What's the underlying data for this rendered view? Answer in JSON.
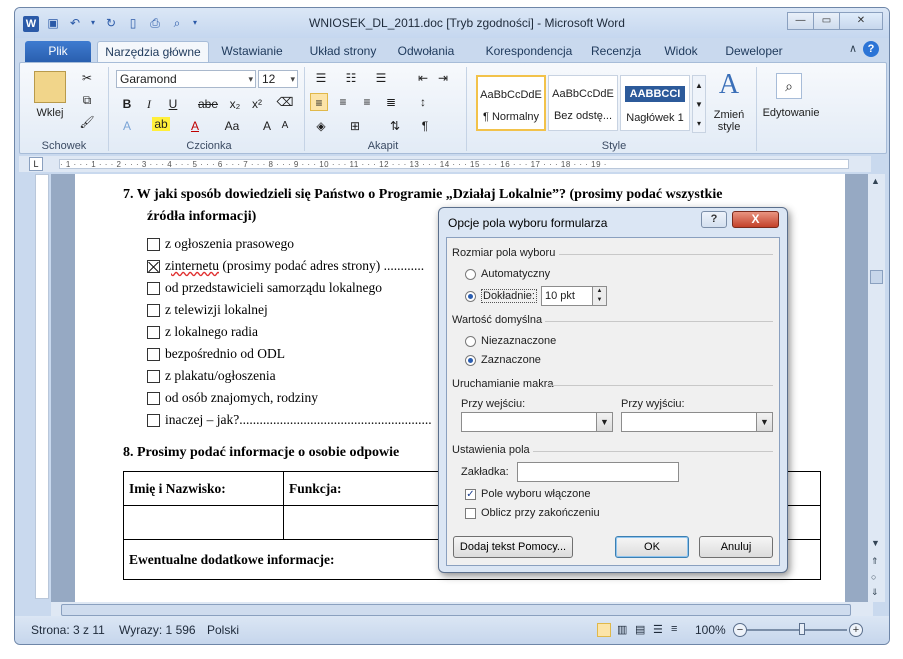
{
  "window": {
    "title": "WNIOSEK_DL_2011.doc [Tryb zgodności] - Microsoft Word",
    "app_letter": "W"
  },
  "tabs": [
    "Plik",
    "Narzędzia główne",
    "Wstawianie",
    "Układ strony",
    "Odwołania",
    "Korespondencja",
    "Recenzja",
    "Widok",
    "Deweloper"
  ],
  "ribbon": {
    "clipboard": {
      "paste": "Wklej",
      "label": "Schowek"
    },
    "font": {
      "family": "Garamond",
      "size": "12",
      "label": "Czcionka",
      "bold": "B",
      "italic": "I",
      "underline": "U",
      "strike": "abe",
      "sub": "x₂",
      "sup": "x²",
      "case": "Aa",
      "grow": "A",
      "shrink": "A"
    },
    "paragraph": {
      "label": "Akapit"
    },
    "styles": {
      "label": "Style",
      "items": [
        {
          "preview": "AaBbCcDdE",
          "name": "¶ Normalny"
        },
        {
          "preview": "AaBbCcDdE",
          "name": "Bez odstę..."
        },
        {
          "preview": "AABBCCI",
          "name": "Nagłówek 1"
        }
      ],
      "change": "Zmień",
      "change2": "style"
    },
    "editing": {
      "label": "Edytowanie"
    }
  },
  "ruler_text": "· 1 · · · 1 · · · 2 · · · 3 · · · 4 · · · 5 · · · 6 · · · 7 · · · 8 · · · 9 · · · 10 · · · 11 · · · 12 · · · 13 · · · 14 · · · 15 · · · 16 · · · 17 · · · 18 · · · 19 ·",
  "document": {
    "q7_line1": "7.   W jaki sposób dowiedzieli się Państwo o Programie „Działaj Lokalnie”? (prosimy podać wszystkie",
    "q7_line2": "źródła informacji)",
    "options": [
      {
        "text": "z ogłoszenia prasowego",
        "checked": false
      },
      {
        "text_pre": "z ",
        "text_sq": "internetu",
        "text_post": " (prosimy podać adres strony) ............",
        "checked": true
      },
      {
        "text": "od przedstawicieli samorządu lokalnego",
        "checked": false
      },
      {
        "text": "z telewizji lokalnej",
        "checked": false
      },
      {
        "text": "z lokalnego radia",
        "checked": false
      },
      {
        "text": "bezpośrednio od ODL",
        "checked": false
      },
      {
        "text": "z plakatu/ogłoszenia",
        "checked": false
      },
      {
        "text": "od osób znajomych, rodziny",
        "checked": false
      },
      {
        "text": "inaczej – jak?.........................................................",
        "checked": false
      }
    ],
    "q8": "8.   Prosimy podać informacje o osobie odpowie",
    "table": {
      "col1": "Imię i Nazwisko:",
      "col2": "Funkcja:",
      "extra": "Ewentualne dodatkowe informacje:"
    }
  },
  "dialog": {
    "title": "Opcje pola wyboru formularza",
    "help": "?",
    "close": "X",
    "size_section": "Rozmiar pola wyboru",
    "auto": "Automatyczny",
    "exact": "Dokładnie:",
    "exact_value": "10 pkt",
    "default_section": "Wartość domyślna",
    "unchecked": "Niezaznaczone",
    "checked": "Zaznaczone",
    "macro_section": "Uruchamianie makra",
    "on_entry": "Przy wejściu:",
    "on_exit": "Przy wyjściu:",
    "field_section": "Ustawienia pola",
    "bookmark": "Zakładka:",
    "enabled": "Pole wyboru włączone",
    "calc_on_exit": "Oblicz przy zakończeniu",
    "help_text_btn": "Dodaj tekst Pomocy...",
    "ok": "OK",
    "cancel": "Anuluj"
  },
  "status": {
    "page": "Strona: 3 z 11",
    "words": "Wyrazy: 1 596",
    "lang": "Polski",
    "zoom": "100%"
  }
}
